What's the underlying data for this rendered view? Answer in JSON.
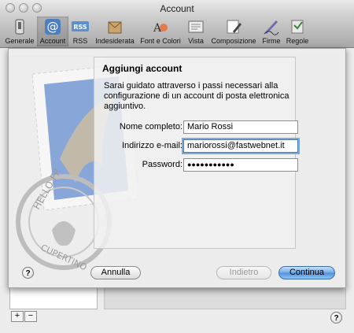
{
  "window": {
    "title": "Account"
  },
  "toolbar": {
    "items": [
      {
        "label": "Generale",
        "icon": "switch-icon"
      },
      {
        "label": "Account",
        "icon": "at-sign-icon",
        "selected": true
      },
      {
        "label": "RSS",
        "icon": "rss-icon"
      },
      {
        "label": "Indesiderata",
        "icon": "junk-mail-icon"
      },
      {
        "label": "Font e Colori",
        "icon": "fonts-colors-icon"
      },
      {
        "label": "Vista",
        "icon": "viewing-icon"
      },
      {
        "label": "Composizione",
        "icon": "composing-icon"
      },
      {
        "label": "Firme",
        "icon": "signatures-icon"
      },
      {
        "label": "Regole",
        "icon": "rules-icon"
      }
    ]
  },
  "sheet": {
    "title": "Aggiungi account",
    "description": "Sarai guidato attraverso i passi necessari alla configurazione di un account di posta elettronica aggiuntivo.",
    "stamp_text_top": "HELLO FR",
    "stamp_text_bottom": "CUPERTINO",
    "fields": {
      "full_name": {
        "label": "Nome completo:",
        "value": "Mario Rossi"
      },
      "email": {
        "label": "Indirizzo e-mail:",
        "value": "mariorossi@fastwebnet.it"
      },
      "password": {
        "label": "Password:",
        "value": "●●●●●●●●●●●"
      }
    },
    "buttons": {
      "cancel": "Annulla",
      "back": "Indietro",
      "continue": "Continua"
    },
    "help": "?"
  },
  "footer": {
    "add": "+",
    "remove": "−",
    "help": "?"
  }
}
